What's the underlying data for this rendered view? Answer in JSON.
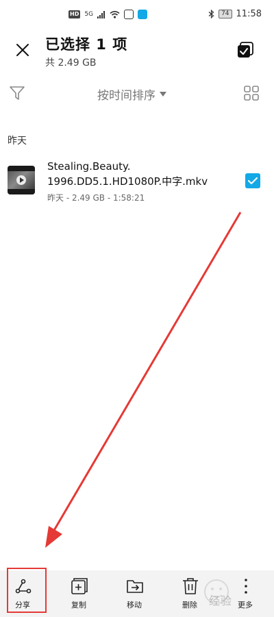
{
  "status_bar": {
    "hd": "HD",
    "network": "5G",
    "battery": "74",
    "time": "11:58"
  },
  "header": {
    "title": "已选择 1 项",
    "subtitle": "共 2.49 GB"
  },
  "toolbar": {
    "sort_label": "按时间排序"
  },
  "section": {
    "label": "昨天"
  },
  "file": {
    "name_line1": "Stealing.Beauty.",
    "name_line2": "1996.DD5.1.HD1080P.中字.mkv",
    "meta": "昨天 - 2.49 GB - 1:58:21",
    "selected": true
  },
  "bottom_actions": [
    {
      "label": "分享",
      "icon": "share-icon"
    },
    {
      "label": "复制",
      "icon": "copy-icon"
    },
    {
      "label": "移动",
      "icon": "move-icon"
    },
    {
      "label": "删除",
      "icon": "delete-icon"
    },
    {
      "label": "更多",
      "icon": "more-icon"
    }
  ],
  "watermark": "经验",
  "colors": {
    "accent": "#13a8e6",
    "annotation": "#e53935",
    "bottom_bar_bg": "#f3f3f3"
  }
}
